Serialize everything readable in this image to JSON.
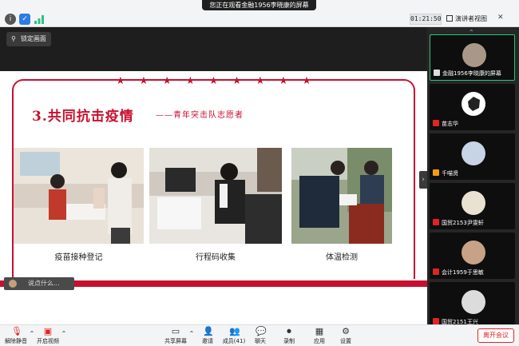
{
  "window": {
    "share_banner": "您正在观看金融1956李晓康的屏幕",
    "timer": "01:21:50",
    "view_button": "演讲者视图",
    "icons": [
      "info-icon",
      "shield-icon",
      "signal-icon"
    ]
  },
  "stage": {
    "lock_label": "锁定画面",
    "say_label": "说点什么..."
  },
  "slide": {
    "title": "3.共同抗击疫情",
    "subtitle": "——青年突击队志愿者",
    "star_count": 9,
    "accent": "#c8102e",
    "photos": [
      {
        "caption": "疫苗接种登记"
      },
      {
        "caption": "行程码收集"
      },
      {
        "caption": "体温检测"
      }
    ]
  },
  "participants": [
    {
      "name": "金融1956李晓康的屏幕",
      "muted": false,
      "active": true
    },
    {
      "name": "苗志华",
      "muted": true
    },
    {
      "name": "千喵贤",
      "muted": false
    },
    {
      "name": "国贸2153尹雯轩",
      "muted": true
    },
    {
      "name": "会计1959于思敏",
      "muted": true
    },
    {
      "name": "国贸2151王兴",
      "muted": true
    }
  ],
  "toolbar": {
    "unmute": "解除静音",
    "start_video": "开启视频",
    "share": "共享屏幕",
    "invite": "邀请",
    "members": "成员(41)",
    "chat": "聊天",
    "record": "录制",
    "apps": "应用",
    "settings": "设置",
    "leave": "离开会议"
  }
}
